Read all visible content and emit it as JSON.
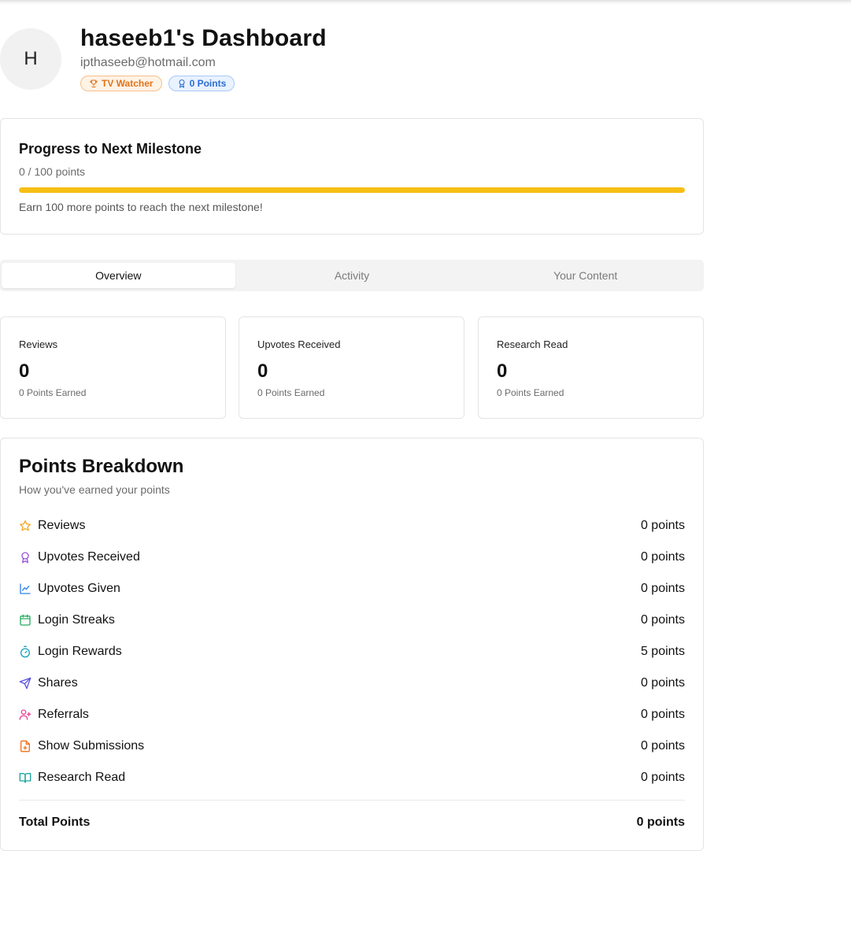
{
  "header": {
    "avatar_initial": "H",
    "title": "haseeb1's Dashboard",
    "email": "ipthaseeb@hotmail.com",
    "badges": [
      {
        "label": "TV Watcher",
        "icon": "trophy-icon",
        "color": "#e0741a"
      },
      {
        "label": "0 Points",
        "icon": "award-icon",
        "color": "#2c6ed5"
      }
    ]
  },
  "progress": {
    "title": "Progress to Next Milestone",
    "points_text": "0 / 100 points",
    "current": 0,
    "target": 100,
    "fraction": 0,
    "message": "Earn 100 more points to reach the next milestone!",
    "bar_color": "#f7bf14"
  },
  "tabs": [
    {
      "label": "Overview",
      "active": true
    },
    {
      "label": "Activity",
      "active": false
    },
    {
      "label": "Your Content",
      "active": false
    }
  ],
  "stats": [
    {
      "label": "Reviews",
      "value": "0",
      "earned": "0 Points Earned"
    },
    {
      "label": "Upvotes Received",
      "value": "0",
      "earned": "0 Points Earned"
    },
    {
      "label": "Research Read",
      "value": "0",
      "earned": "0 Points Earned"
    }
  ],
  "breakdown": {
    "title": "Points Breakdown",
    "subtitle": "How you've earned your points",
    "rows": [
      {
        "label": "Reviews",
        "points": "0 points",
        "icon": "star-icon",
        "color": "#f5a623"
      },
      {
        "label": "Upvotes Received",
        "points": "0 points",
        "icon": "award-icon",
        "color": "#9b51e0"
      },
      {
        "label": "Upvotes Given",
        "points": "0 points",
        "icon": "trend-chart-icon",
        "color": "#2f80ed"
      },
      {
        "label": "Login Streaks",
        "points": "0 points",
        "icon": "calendar-icon",
        "color": "#27ae60"
      },
      {
        "label": "Login Rewards",
        "points": "5 points",
        "icon": "timer-icon",
        "color": "#17a2b8"
      },
      {
        "label": "Shares",
        "points": "0 points",
        "icon": "send-icon",
        "color": "#5b4fe0"
      },
      {
        "label": "Referrals",
        "points": "0 points",
        "icon": "user-plus-icon",
        "color": "#e84393"
      },
      {
        "label": "Show Submissions",
        "points": "0 points",
        "icon": "file-plus-icon",
        "color": "#f2711c"
      },
      {
        "label": "Research Read",
        "points": "0 points",
        "icon": "book-open-icon",
        "color": "#1aa39a"
      }
    ],
    "total_label": "Total Points",
    "total_value": "0 points"
  }
}
